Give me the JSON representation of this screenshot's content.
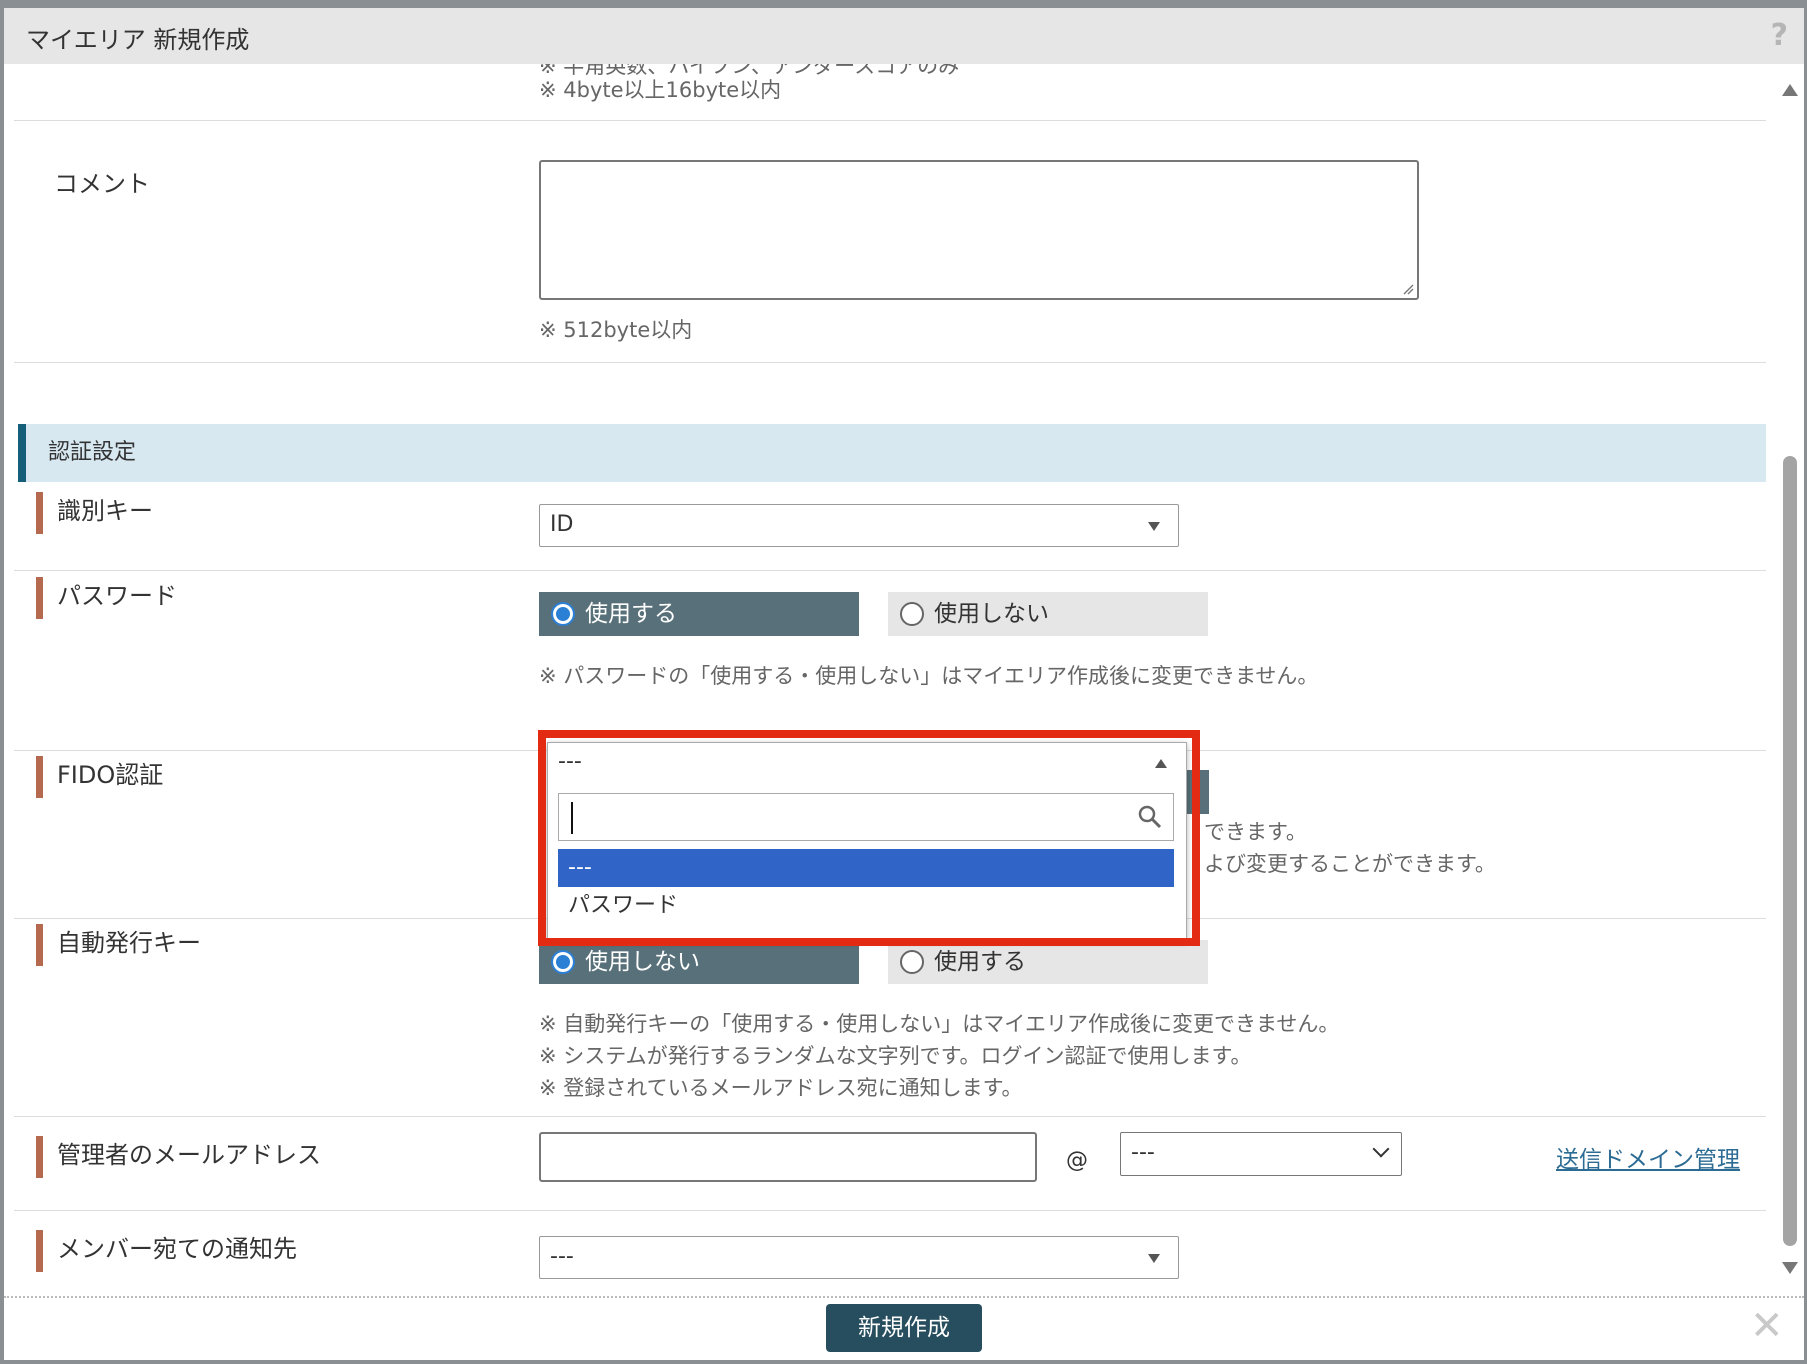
{
  "dialog": {
    "title": "マイエリア 新規作成",
    "help": "?"
  },
  "top_notes": {
    "cut_line": "※ 半角英数、ハイフン、アンダースコアのみ",
    "length": "※ 4byte以上16byte以内"
  },
  "comment": {
    "label": "コメント",
    "note": "※ 512byte以内"
  },
  "auth_section": {
    "title": "認証設定"
  },
  "identifier_key": {
    "label": "識別キー",
    "value": "ID"
  },
  "password": {
    "label": "パスワード",
    "option_use": "使用する",
    "option_nouse": "使用しない",
    "selected": "使用する",
    "note": "※ パスワードの「使用する・使用しない」はマイエリア作成後に変更できません。"
  },
  "password_dropdown": {
    "current": "---",
    "search_placeholder": "",
    "options": [
      "---",
      "パスワード"
    ],
    "highlighted": "---"
  },
  "fido": {
    "label": "FIDO認証",
    "note1_tail": "できます。",
    "note2_tail": "よび変更することができます。"
  },
  "auto_key": {
    "label": "自動発行キー",
    "option_nouse": "使用しない",
    "option_use": "使用する",
    "selected": "使用しない",
    "notes": [
      "※ 自動発行キーの「使用する・使用しない」はマイエリア作成後に変更できません。",
      "※ システムが発行するランダムな文字列です。ログイン認証で使用します。",
      "※ 登録されているメールアドレス宛に通知します。"
    ]
  },
  "admin_email": {
    "label": "管理者のメールアドレス",
    "local_value": "",
    "at": "@",
    "domain_value": "---",
    "domain_link": "送信ドメイン管理"
  },
  "member_notify": {
    "label": "メンバー宛ての通知先",
    "value": "---"
  },
  "footer": {
    "create_button": "新規作成",
    "close": "✕"
  },
  "colors": {
    "label_accent": "#b56a50",
    "section_bg": "#d7e8f1",
    "section_accent": "#165f7b",
    "radio_selected_bg": "#587079",
    "primary_button": "#274e5e",
    "dropdown_selected": "#3065c7",
    "highlight_box": "#e32b14",
    "link": "#2c6c94"
  }
}
